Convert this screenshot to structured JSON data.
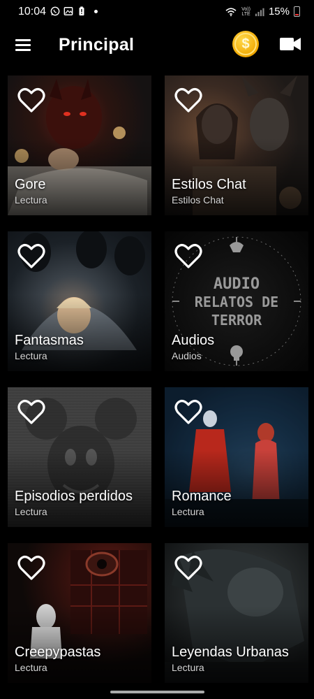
{
  "status_bar": {
    "time": "10:04",
    "battery_percent": "15%",
    "network": "LTE",
    "volte": "Vo)) LTE"
  },
  "app_bar": {
    "title": "Principal",
    "menu_icon": "hamburger-menu-icon",
    "coin_icon": "dollar-coin-icon",
    "coin_symbol": "$",
    "video_icon": "video-camera-icon"
  },
  "categories": [
    {
      "title": "Gore",
      "subtitle": "Lectura"
    },
    {
      "title": "Estilos Chat",
      "subtitle": "Estilos Chat"
    },
    {
      "title": "Fantasmas",
      "subtitle": "Lectura"
    },
    {
      "title": "Audios",
      "subtitle": "Audios"
    },
    {
      "title": "Episodios perdidos",
      "subtitle": "Lectura"
    },
    {
      "title": "Romance",
      "subtitle": "Lectura"
    },
    {
      "title": "Creepypastas",
      "subtitle": "Lectura"
    },
    {
      "title": "Leyendas Urbanas",
      "subtitle": "Lectura"
    }
  ],
  "artwork_text": {
    "audios_logo": [
      "AUDIO",
      "RELATOS DE",
      "TERROR"
    ]
  },
  "colors": {
    "background": "#000000",
    "coin": "#f1a800",
    "text": "#ffffff"
  }
}
